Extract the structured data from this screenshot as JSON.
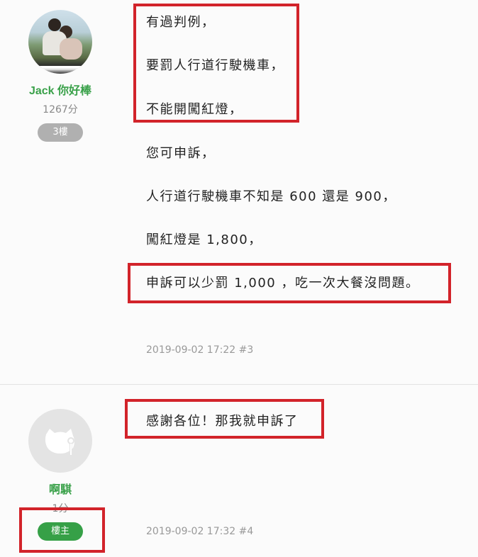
{
  "posts": [
    {
      "author": {
        "name": "Jack 你好棒",
        "score": "1267分",
        "badge": "3樓"
      },
      "lines": [
        "有過判例，",
        "要罰人行道行駛機車，",
        "不能開闖紅燈，",
        "您可申訴，",
        "人行道行駛機車不知是 600 還是 900，",
        "闖紅燈是 1,800，",
        "申訴可以少罰 1,000 ，吃一次大餐沒問題。"
      ],
      "meta": "2019-09-02 17:22 #3"
    },
    {
      "author": {
        "name": "啊騏",
        "score": "1分",
        "badge": "樓主"
      },
      "lines": [
        "感謝各位！那我就申訴了"
      ],
      "meta": "2019-09-02 17:32 #4"
    }
  ],
  "colors": {
    "name": "#3aa14a",
    "highlight": "#d2232a",
    "op_badge": "#36a047",
    "floor_badge": "#b0b0b0"
  },
  "icons": {
    "default_avatar": "cat-silhouette-icon"
  }
}
